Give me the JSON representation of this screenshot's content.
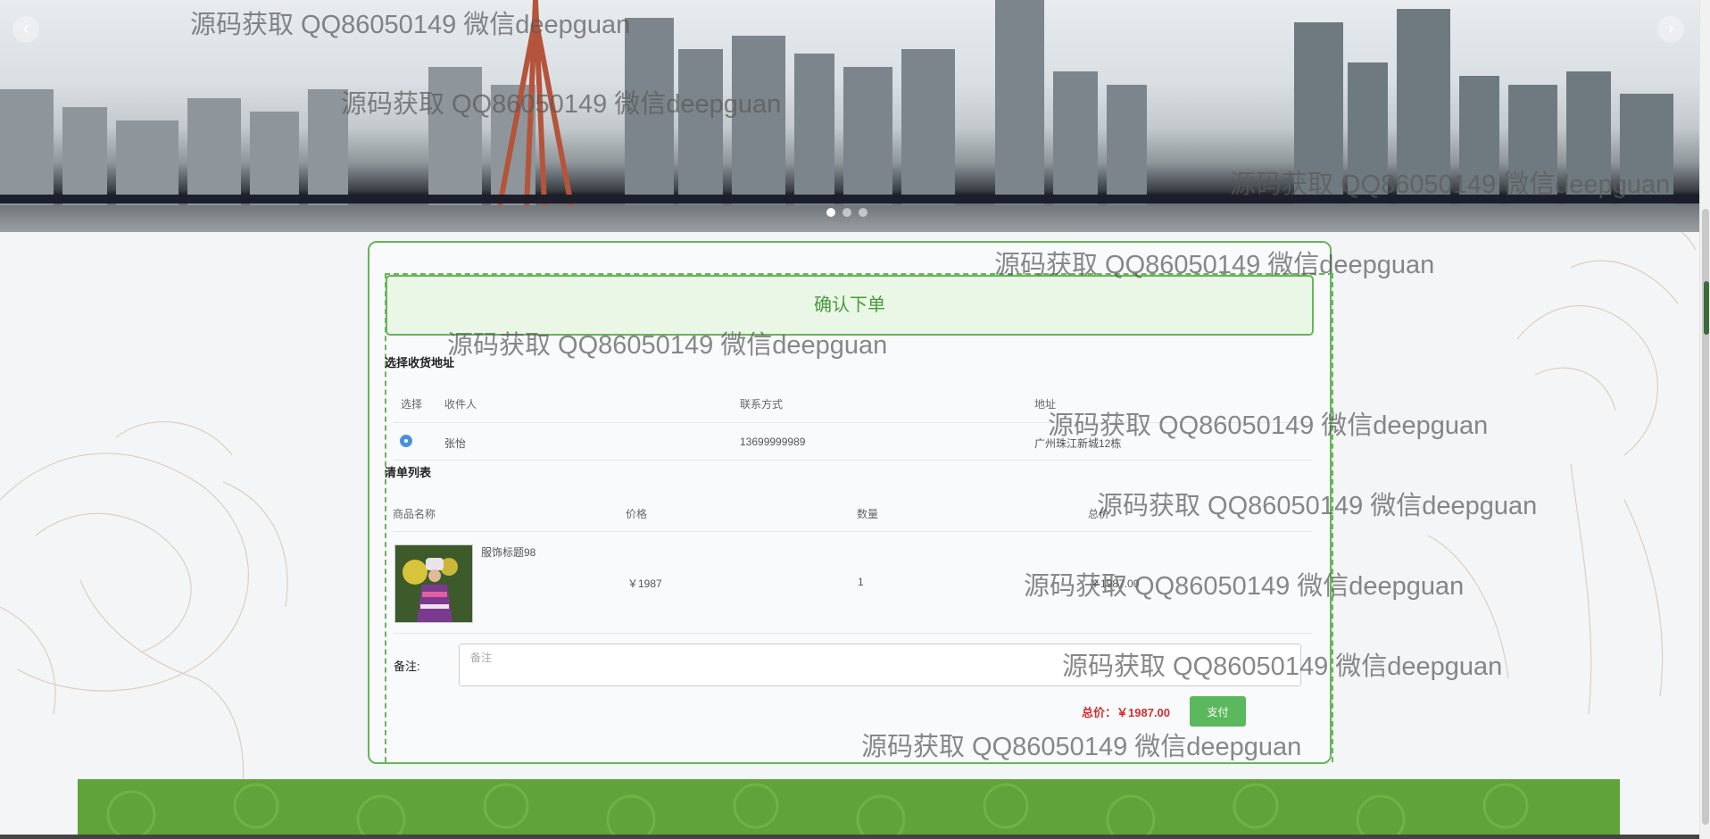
{
  "banner": {
    "prev_icon": "‹",
    "next_icon": "›",
    "slide_count": 3,
    "active_slide": 1
  },
  "order": {
    "title": "确认下单",
    "address_section": "选择收货地址",
    "address_headers": {
      "select": "选择",
      "recipient": "收件人",
      "phone": "联系方式",
      "address": "地址"
    },
    "address_row": {
      "selected": true,
      "recipient": "张怡",
      "phone": "13699999989",
      "address": "广州珠江新城12栋"
    },
    "items_section": "清单列表",
    "item_headers": {
      "name": "商品名称",
      "price": "价格",
      "qty": "数量",
      "total": "总价"
    },
    "item": {
      "name": "服饰标题98",
      "price": "￥1987",
      "qty": "1",
      "total": "￥1987.00"
    },
    "remark_label": "备注:",
    "remark_placeholder": "备注",
    "total_label": "总价：￥1987.00",
    "pay_button": "支付"
  },
  "watermark": "源码获取 QQ86050149 微信deepguan",
  "colors": {
    "accent": "#67b559",
    "pay": "#5cb85c",
    "price": "#d32f2f",
    "footer": "#5fa33a"
  }
}
